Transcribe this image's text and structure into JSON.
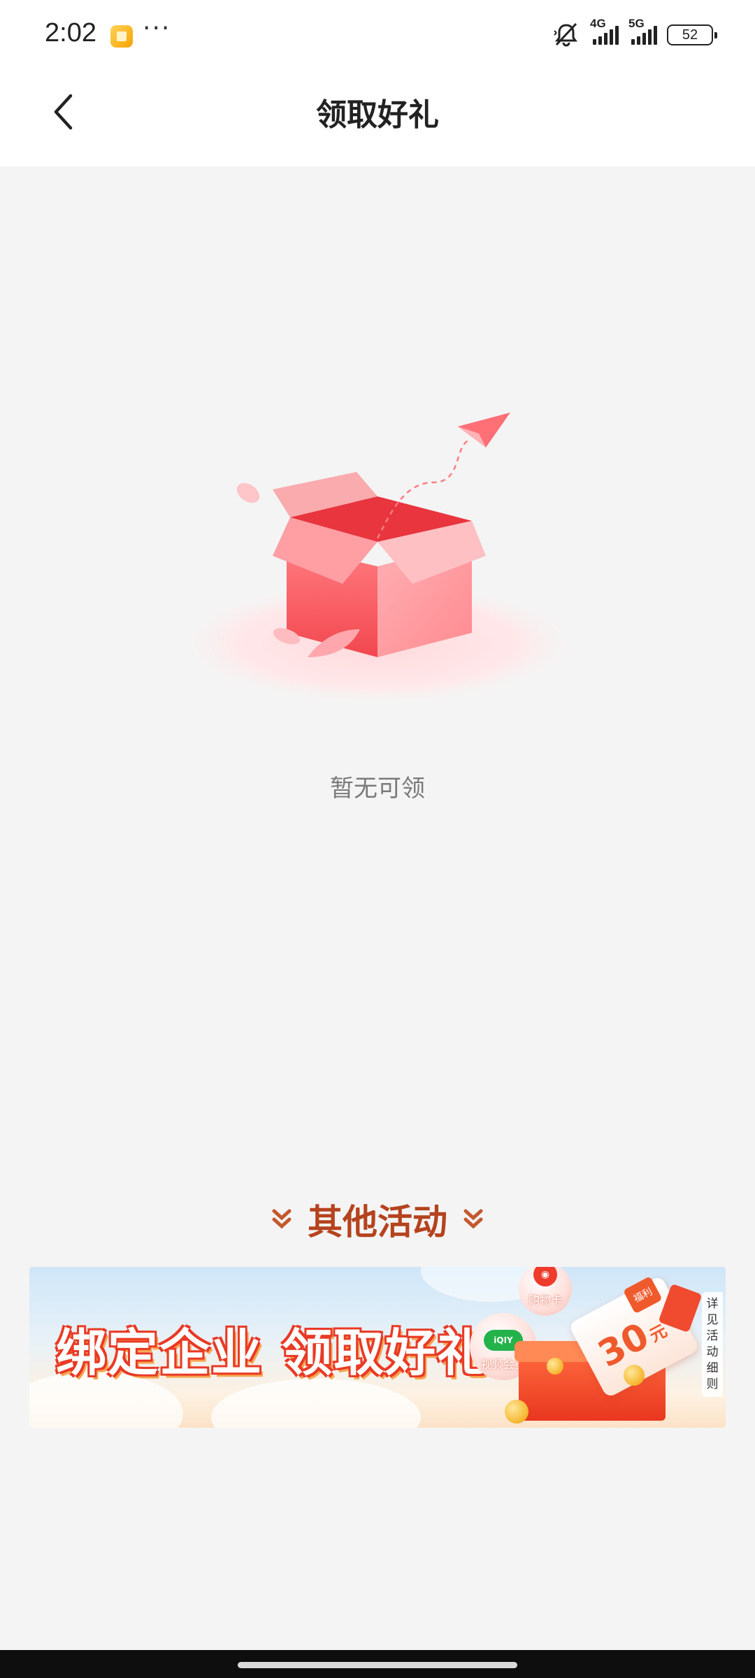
{
  "status_bar": {
    "time": "2:02",
    "dots": "···",
    "network_1": "4G",
    "network_2": "5G",
    "battery": "52"
  },
  "nav": {
    "title": "领取好礼"
  },
  "empty_state": {
    "message": "暂无可领"
  },
  "other_activities": {
    "title": "其他活动",
    "banner": {
      "headline": "绑定企业 领取好礼",
      "bubble_1": "购物卡",
      "bubble_2": "视频会员",
      "iqiyi_logo": "iQIY",
      "voucher_amount": "30",
      "voucher_unit": "元",
      "voucher_tag": "福利",
      "rules_chars": [
        "详",
        "见",
        "活",
        "动",
        "细",
        "则"
      ]
    }
  },
  "colors": {
    "accent": "#b5431e",
    "banner_red": "#e93a25",
    "background": "#f4f4f4"
  }
}
